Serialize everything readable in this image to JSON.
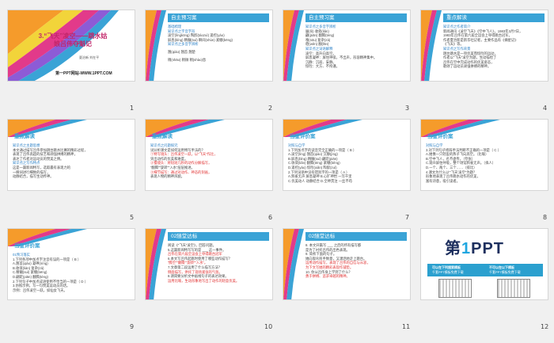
{
  "thumbnails": [
    {
      "num": "1"
    },
    {
      "num": "2"
    },
    {
      "num": "3"
    },
    {
      "num": "4"
    },
    {
      "num": "5"
    },
    {
      "num": "6"
    },
    {
      "num": "7"
    },
    {
      "num": "8"
    },
    {
      "num": "9"
    },
    {
      "num": "10"
    },
    {
      "num": "11"
    },
    {
      "num": "12"
    }
  ],
  "s1": {
    "title1": "3.“飞天”凌空——跳水姑",
    "title2": "娘吕伟夺魁记",
    "authors": "夏治新  刘在平",
    "site": "第一PPT网站-WWW.1PPT.COM"
  },
  "s2": {
    "title": "自主预习案",
    "lines": [
      "基础梳理",
      "知识点之字音字形",
      "凌空(língkōng)  陶醉(táozuì)  遥控(yáo)",
      "屏息(bǐng)  精髓(suǐ)  瞬间(shùn)  紧绷(bēng)",
      "知识点之多音字辨析",
      "  翘(qiào)  翘首  翘楚",
      "  稍(shāo)  稍微  稍(shào)息"
    ]
  },
  "s3": {
    "title": "自主预习案",
    "lines": [
      "知识点之多音字辨析",
      "  屡(lǚ)    收敛(liǎn)",
      "  翩(piān)   翻腾(téng)",
      "  嗖(sōu)    复杂(zá)",
      "  稳(wěn)   翻(fān)",
      "知识点之词语解释",
      "凌空：高升向高空。",
      "屏息凝神：屏住呼吸，不出声，形容精神集中。",
      "沉静：沉寂、安静。",
      "惊险：大方、不拘谨。"
    ]
  },
  "s4": {
    "title": "重点解读",
    "lines": [
      "知识点之作者简介",
      "  新闻通讯《凌空飞天》《空中飞人》，1983年3月7日，",
      "  1983年吕伟在第六届全运会上夺得跳台冠军。",
      "  作者夏治新是新华社记者，主要作品有《摘星记》",
      "  《飞天》等。",
      "知识点之写作背景",
      "  跳台跳水是一项优美而惊险的运动，",
      "  作者以“飞天”凌空为题，生动描绘了",
      "  吕伟在空中完成动作的优美姿态，",
      "  歌颂了运动员顽强拼搏的精神。"
    ]
  },
  "s5": {
    "title": "重点解读",
    "lines": [
      "知识点之主题思想",
      "  本文通过描写吕伟参加跳台跳水比赛的精彩过程，",
      "  表现了吕伟高超的技艺和顽强拼搏的精神，",
      "  表达了作者对运动员的赞美之情。",
      "知识点之写作特点",
      "  这是一篇新闻特写，选取最有表现力的",
      "  一瞬间进行细致的描写，",
      "  动静结合，描写生动传神。"
    ]
  },
  "s6": {
    "title": "重点解读",
    "lines": [
      "知识点之问题探究",
      "  试分析课文是如何运用特写手法的？",
      "  ①特写镜头：吕伟凌空一跃，以“飞天”作比，",
      "  突出动作的优美和难度。",
      "  ②慢镜头：将短短几秒的动作分解描写，",
      "  “翻腾”“旋转”“入水”层层推进。",
      "  ③细节描写：通过对动作、神态的刻画，",
      "  表现人物的精神风貌。"
    ]
  },
  "s7": {
    "title": "当堂评价案",
    "lines": [
      "对照与自学",
      "1.下列加点字的读音完全正确的一项是（ B ）",
      "A.凌空(líng)  翘首(qiào)  沉静(jìng)",
      "B.屏息(bǐng)  精髓(suǐ)  翩跹(piān)",
      "C.收敛(liǎn)  翻腾(téng)  紧绷(běng)",
      "D.遥控(yáo)  惊险(xiǎn)  陶醉(zuì)",
      "2.下列词语中没有错别字的一项是（ A ）",
      "A.鸦雀无声  屏息凝神  B.心旷神怡  一泻千里",
      "C.优美动人  动静结合  D.全神贯注  一丝不苟"
    ]
  },
  "s8": {
    "title": "当堂评价案",
    "lines": [
      "对照与自学",
      "3.对下列句子修辞手法判断不正确的一项是（ C ）",
      "A.她像一只轻盈的燕子飞向高空。（比喻）",
      "B.空中飞人，名不虚传。（夸张）",
      "C.观众屏住呼吸，整个场馆鸦雀无声。（拟人）",
      "D.一个、两个、三个……（排比）",
      "4.课文为什么以“‘飞天’凌空”为题？",
      "  形象地表现了吕伟跳水动作的优美，",
      "  富有诗意，吸引读者。"
    ]
  },
  "s9": {
    "title": "当堂评价案",
    "lines": [
      "01预习落实",
      "1.下列各项中加点字注音有误的一项是（ B ）",
      "A.翘首(qiào)  凝神(níng)",
      "B.收敛(liàn)  复杂(zá)",
      "C.精髓(suǐ)  紧绷(bēng)",
      "D.翩跹(piān)  翻腾(téng)",
      "2.下列句子中加点成语使用不恰当的一项是（ D ）",
      "3.仿照示例，写一句赞美运动员的话。",
      "  示例：吕伟凌空一跃，如仙女飞天。"
    ]
  },
  "s10": {
    "title": "02随堂达标",
    "lines": [
      "阅读《“飞天”凌空》，回答问题。",
      "5.这篇新闻特写写的是 ___ 这一事件。",
      "  吕伟在第六届全运会上夺得跳台冠军",
      "6.本文写吕伟起跳时使用了哪些动作描写？",
      "  “腾空”“翻腾”“旋转”“入水”。",
      "7.文章第二段运用了什么描写方法？",
      "  侧面描写，烘托了现场紧张的气氛。",
      "8.请简要分析文中画线句子的表达效果。",
      "  运用比喻，生动形象地写出了动作的轻盈优美。"
    ]
  },
  "s11": {
    "title": "02随堂达标",
    "lines": [
      "8. 本文开篇写 ___ 之后的所有描写都",
      "   是为了衬托吕伟的出色表现。",
      "9. 简析下面的句子。",
      "   她向观众挥手致意，又潇洒地走上跳台。",
      "   运用动作描写，表现了吕伟的自信与从容，",
      "   为下文写她的精彩表现作铺垫。",
      "10. 你从吕伟身上学到了什么？",
      "   勇于拼搏、追求卓越的精神。"
    ]
  },
  "s12": {
    "logo_main": "第",
    "logo_one": "1",
    "logo_tail": "PPT",
    "strip_left": "可以在下列搜索模板",
    "strip_mid": "千套PPT模板免费下载",
    "strip_right": "不可以在以下模板",
    "strip_right2": "千套PPT模板免费下载"
  }
}
